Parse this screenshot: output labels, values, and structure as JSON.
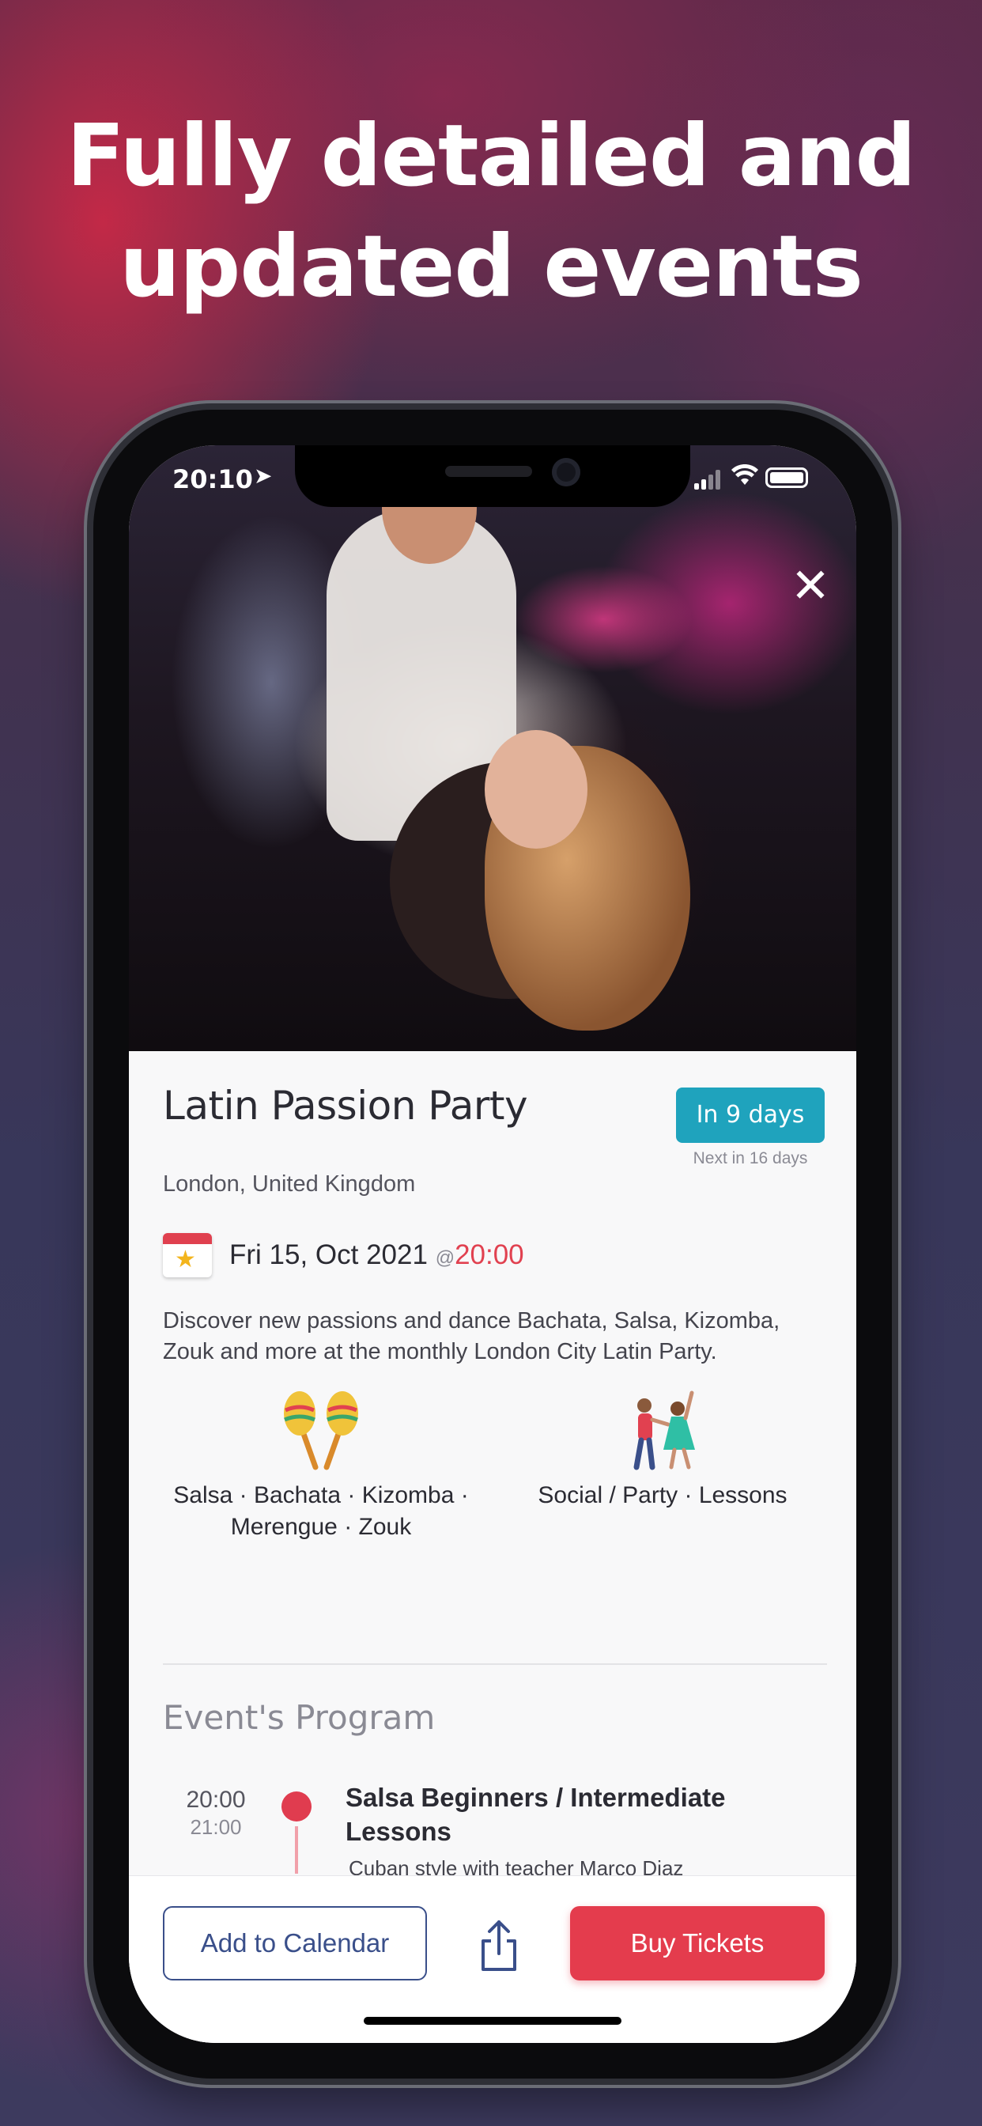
{
  "promo": {
    "headline_line1": "Fully detailed and",
    "headline_line2": "updated events"
  },
  "status_bar": {
    "time": "20:10",
    "location_icon": "location-arrow-icon",
    "signal_icon": "signal-icon",
    "wifi_icon": "wifi-icon",
    "battery_icon": "battery-icon"
  },
  "hero": {
    "close_icon": "close-icon",
    "close_glyph": "✕"
  },
  "event": {
    "title": "Latin Passion Party",
    "badge": "In 9 days",
    "next": "Next in 16 days",
    "location": "London, United Kingdom",
    "date": "Fri 15, Oct 2021",
    "at": "@",
    "time": "20:00",
    "description": "Discover new passions and dance Bachata, Salsa, Kizomba, Zouk and more at the monthly London City Latin Party.",
    "styles_line1": "Salsa · Bachata · Kizomba ·",
    "styles_line2": "Merengue · Zouk",
    "types": "Social / Party · Lessons"
  },
  "program": {
    "title": "Event's Program",
    "items": [
      {
        "start": "20:00",
        "end": "21:00",
        "title": "Salsa Beginners / Intermediate Lessons",
        "subtitle": "Cuban style with teacher Marco Diaz"
      }
    ]
  },
  "actions": {
    "add_to_calendar": "Add to Calendar",
    "share_icon": "share-icon",
    "buy_tickets": "Buy Tickets"
  },
  "colors": {
    "accent_red": "#e43c4d",
    "badge_teal": "#1fa3bd",
    "outline_blue": "#3a4f8a"
  }
}
